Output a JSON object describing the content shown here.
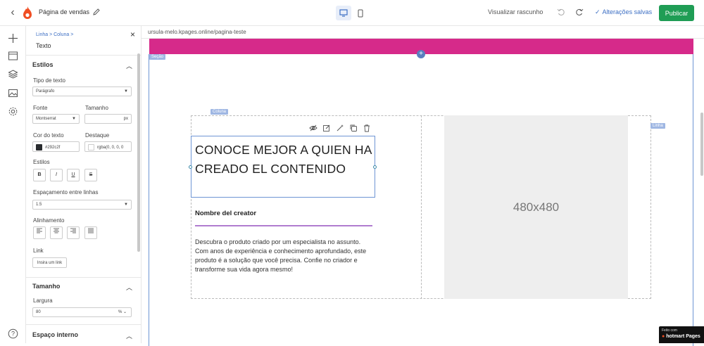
{
  "topbar": {
    "page_name": "Página de vendas",
    "preview_label": "Visualizar rascunho",
    "saved_label": "Alterações salvas",
    "publish_label": "Publicar"
  },
  "panel": {
    "breadcrumb": "Linha  >  Coluna  >",
    "title": "Texto",
    "styles_section": "Estilos",
    "text_type_label": "Tipo de texto",
    "text_type_value": "Parágrafo",
    "font_label": "Fonte",
    "font_value": "Montserrat",
    "size_label": "Tamanho",
    "size_unit": "px",
    "text_color_label": "Cor do texto",
    "text_color_value": "#292c2f",
    "highlight_label": "Destaque",
    "highlight_value": "rgba(0, 0, 0, 0",
    "styles_label": "Estilos",
    "style_buttons": [
      "B",
      "I",
      "U",
      "S"
    ],
    "line_spacing_label": "Espaçamento entre linhas",
    "line_spacing_value": "1.5",
    "alignment_label": "Alinhamento",
    "link_label": "Link",
    "link_button": "Insira um link",
    "size_section": "Tamanho",
    "width_label": "Largura",
    "width_value": "80",
    "width_unit": "%",
    "padding_section": "Espaço interno"
  },
  "canvas": {
    "url": "ursula-melo.kpages.online/pagina-teste",
    "section_tag": "Seção",
    "column_tag": "Coluna",
    "row_tag": "Linha",
    "headline": "CONOCE MEJOR A QUIEN HA CREADO EL CONTENIDO",
    "creator_name": "Nombre del creator",
    "description": "Descubra o produto criado por um especialista no assunto. Com anos de experiência e conhecimento aprofundado, este produto é a solução que você precisa. Confie no criador e transforme sua vida agora mesmo!",
    "image_placeholder": "480x480"
  },
  "badge": {
    "small": "Feito com",
    "big": "hotmart Pages"
  },
  "colors": {
    "accent": "#3d6fc4",
    "publish": "#1f9d55",
    "pink_bar": "#d62a8a",
    "text_color_swatch": "#292c2f"
  }
}
